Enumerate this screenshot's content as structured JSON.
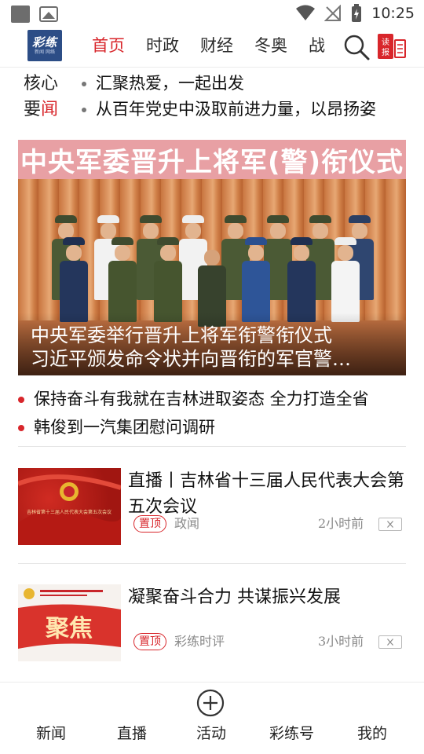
{
  "status_bar": {
    "time": "10:25"
  },
  "header": {
    "logo_text": "彩练",
    "logo_sub": "新闻 网络",
    "tabs": [
      {
        "label": "首页",
        "active": true
      },
      {
        "label": "时政",
        "active": false
      },
      {
        "label": "财经",
        "active": false
      },
      {
        "label": "冬奥",
        "active": false
      },
      {
        "label": "战",
        "active": false
      }
    ],
    "read_label": "读报"
  },
  "core_news": {
    "label_line1": "核心",
    "label_line2_a": "要",
    "label_line2_b": "闻",
    "items": [
      "汇聚热爱，一起出发",
      "从百年党史中汲取前进力量，以昂扬姿"
    ]
  },
  "hero": {
    "banner_text": "中央军委晋升上将军(警)衔仪式",
    "caption_line1": "中央军委举行晋升上将军衔警衔仪式",
    "caption_line2": "习近平颁发命令状并向晋衔的军官警…"
  },
  "headlines": [
    "保持奋斗有我就在吉林进取姿态 全力打造全省",
    "韩俊到一汽集团慰问调研"
  ],
  "cards": [
    {
      "title": "直播丨吉林省十三届人民代表大会第五次会议",
      "badge": "置顶",
      "source": "政闻",
      "time": "2小时前",
      "thumb_text": "吉林省第十三届人民代表大会第五次会议"
    },
    {
      "title": "凝聚奋斗合力 共谋振兴发展",
      "badge": "置顶",
      "source": "彩练时评",
      "time": "3小时前",
      "thumb_text": "聚焦"
    }
  ],
  "bottom_nav": [
    {
      "label": "新闻"
    },
    {
      "label": "直播"
    },
    {
      "label": "活动"
    },
    {
      "label": "彩练号"
    },
    {
      "label": "我的"
    }
  ],
  "colors": {
    "accent": "#d8262b",
    "logo_bg": "#2c4d86"
  }
}
